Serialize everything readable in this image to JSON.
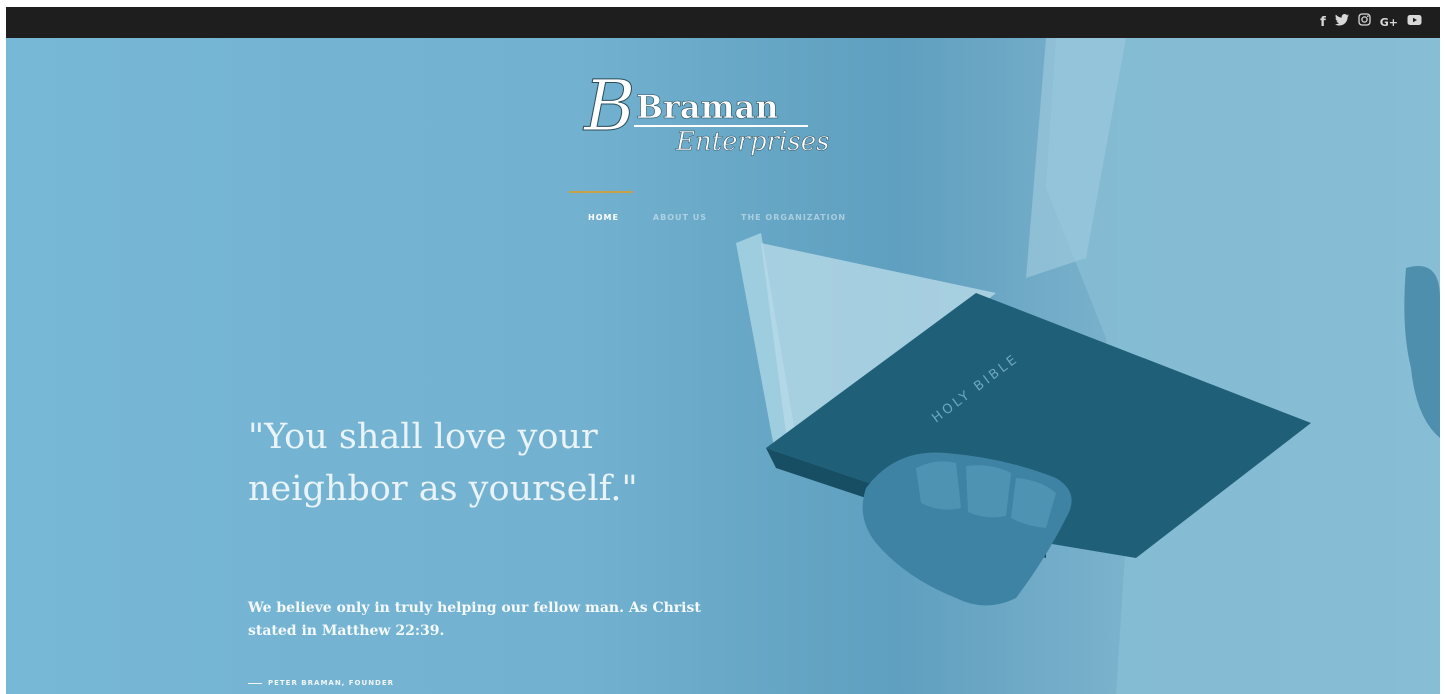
{
  "social": {
    "icons": [
      "facebook-icon",
      "twitter-icon",
      "instagram-icon",
      "google-plus-icon",
      "youtube-icon"
    ],
    "glyphs": [
      "f",
      "🐦",
      "◎",
      "G+",
      "▶"
    ]
  },
  "logo": {
    "line1": "Braman",
    "line2": "Enterprises"
  },
  "nav": {
    "home": "HOME",
    "about": "ABOUT US",
    "organization": "THE ORGANIZATION"
  },
  "hero": {
    "quote_line1": "\"You shall love your",
    "quote_line2": "neighbor as yourself.\"",
    "desc_line1": "We believe only in truly helping our fellow man. As Christ",
    "desc_line2": "stated in Matthew 22:39.",
    "author": "PETER BRAMAN, FOUNDER",
    "book_spine": "HOLY BIBLE"
  },
  "colors": {
    "topbar": "#1e1e1e",
    "hero_blue": "#75b5d2",
    "accent_gold": "#c8a24a",
    "book_dark": "#1f5f78"
  }
}
